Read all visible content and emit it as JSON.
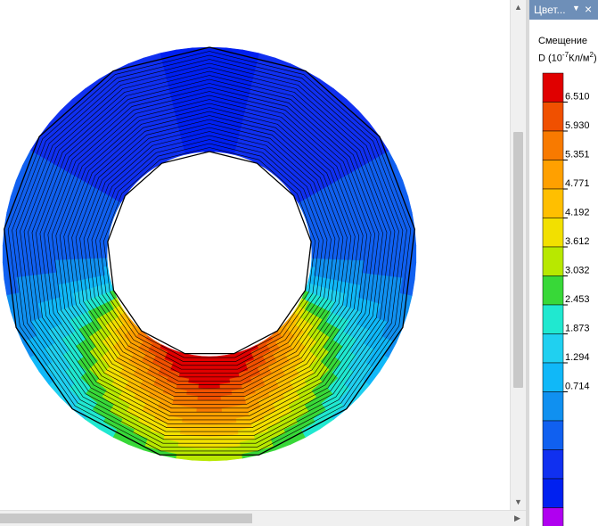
{
  "panel": {
    "title": "Цвет...",
    "menu_glyph": "▼",
    "close_glyph": "×"
  },
  "legend": {
    "quantity": "Смещение",
    "symbol": "D",
    "unit_base": "(10",
    "unit_exp": "-7",
    "unit_mid": "Кл/м",
    "unit_exp2": "2",
    "unit_close": ")",
    "tick_labels": [
      "6.510",
      "5.930",
      "5.351",
      "4.771",
      "4.192",
      "3.612",
      "3.032",
      "2.453",
      "1.873",
      "1.294",
      "0.714"
    ],
    "colors": [
      "#e00000",
      "#f05000",
      "#f87a00",
      "#ffa000",
      "#ffbf00",
      "#f2e000",
      "#b8e800",
      "#38d838",
      "#20e8d0",
      "#20d0f0",
      "#10b8f8",
      "#1090f0",
      "#1060f0",
      "#1030f0",
      "#0020f0",
      "#b000f0"
    ]
  },
  "contour": {
    "inner_radius": 1,
    "outer_radius": 2,
    "min_value": 0.714,
    "max_value": 6.51
  },
  "scrollbars": {
    "up_glyph": "▲",
    "down_glyph": "▼",
    "left_glyph": "◀",
    "right_glyph": "▶"
  }
}
